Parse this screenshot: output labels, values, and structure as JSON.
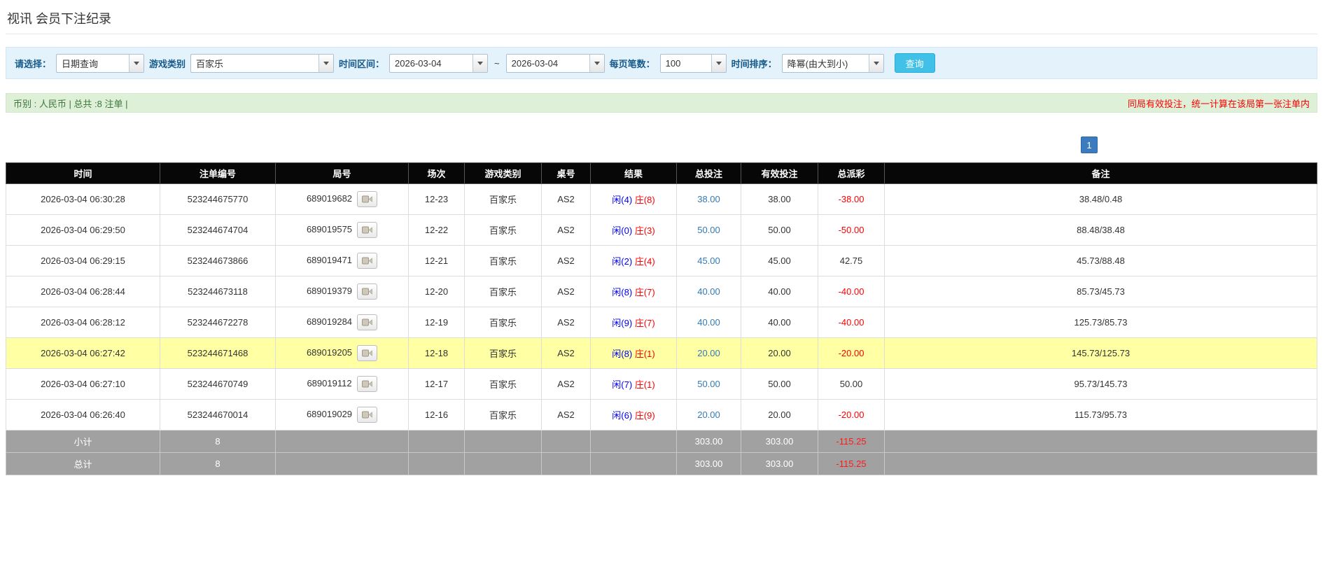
{
  "page": {
    "title": "视讯 会员下注纪录"
  },
  "filters": {
    "select_label": "请选择：",
    "select_value": "日期查询",
    "game_type_label": "游戏类别",
    "game_type_value": "百家乐",
    "time_range_label": "时间区间：",
    "date_from": "2026-03-04",
    "date_separator": "~",
    "date_to": "2026-03-04",
    "page_size_label": "每页笔数：",
    "page_size_value": "100",
    "sort_label": "时间排序：",
    "sort_value": "降幂(由大到小)",
    "search_button": "查询"
  },
  "summary": {
    "left": "币别 : 人民币 | 总共 :8 注单 |",
    "right": "同局有效投注，统一计算在该局第一张注单内"
  },
  "pagination": {
    "current": "1"
  },
  "table": {
    "headers": [
      "时间",
      "注单编号",
      "局号",
      "场次",
      "游戏类别",
      "桌号",
      "结果",
      "总投注",
      "有效投注",
      "总派彩",
      "备注"
    ],
    "rows": [
      {
        "time": "2026-03-04 06:30:28",
        "bet_id": "523244675770",
        "round_id": "689019682",
        "session": "12-23",
        "game": "百家乐",
        "table_no": "AS2",
        "player": "闲(4)",
        "banker": "庄(8)",
        "total_bet": "38.00",
        "valid_bet": "38.00",
        "payout": "-38.00",
        "remark": "38.48/0.48",
        "highlight": false
      },
      {
        "time": "2026-03-04 06:29:50",
        "bet_id": "523244674704",
        "round_id": "689019575",
        "session": "12-22",
        "game": "百家乐",
        "table_no": "AS2",
        "player": "闲(0)",
        "banker": "庄(3)",
        "total_bet": "50.00",
        "valid_bet": "50.00",
        "payout": "-50.00",
        "remark": "88.48/38.48",
        "highlight": false
      },
      {
        "time": "2026-03-04 06:29:15",
        "bet_id": "523244673866",
        "round_id": "689019471",
        "session": "12-21",
        "game": "百家乐",
        "table_no": "AS2",
        "player": "闲(2)",
        "banker": "庄(4)",
        "total_bet": "45.00",
        "valid_bet": "45.00",
        "payout": "42.75",
        "remark": "45.73/88.48",
        "highlight": false
      },
      {
        "time": "2026-03-04 06:28:44",
        "bet_id": "523244673118",
        "round_id": "689019379",
        "session": "12-20",
        "game": "百家乐",
        "table_no": "AS2",
        "player": "闲(8)",
        "banker": "庄(7)",
        "total_bet": "40.00",
        "valid_bet": "40.00",
        "payout": "-40.00",
        "remark": "85.73/45.73",
        "highlight": false
      },
      {
        "time": "2026-03-04 06:28:12",
        "bet_id": "523244672278",
        "round_id": "689019284",
        "session": "12-19",
        "game": "百家乐",
        "table_no": "AS2",
        "player": "闲(9)",
        "banker": "庄(7)",
        "total_bet": "40.00",
        "valid_bet": "40.00",
        "payout": "-40.00",
        "remark": "125.73/85.73",
        "highlight": false
      },
      {
        "time": "2026-03-04 06:27:42",
        "bet_id": "523244671468",
        "round_id": "689019205",
        "session": "12-18",
        "game": "百家乐",
        "table_no": "AS2",
        "player": "闲(8)",
        "banker": "庄(1)",
        "total_bet": "20.00",
        "valid_bet": "20.00",
        "payout": "-20.00",
        "remark": "145.73/125.73",
        "highlight": true
      },
      {
        "time": "2026-03-04 06:27:10",
        "bet_id": "523244670749",
        "round_id": "689019112",
        "session": "12-17",
        "game": "百家乐",
        "table_no": "AS2",
        "player": "闲(7)",
        "banker": "庄(1)",
        "total_bet": "50.00",
        "valid_bet": "50.00",
        "payout": "50.00",
        "remark": "95.73/145.73",
        "highlight": false
      },
      {
        "time": "2026-03-04 06:26:40",
        "bet_id": "523244670014",
        "round_id": "689019029",
        "session": "12-16",
        "game": "百家乐",
        "table_no": "AS2",
        "player": "闲(6)",
        "banker": "庄(9)",
        "total_bet": "20.00",
        "valid_bet": "20.00",
        "payout": "-20.00",
        "remark": "115.73/95.73",
        "highlight": false
      }
    ],
    "subtotal": {
      "label": "小计",
      "count": "8",
      "total_bet": "303.00",
      "valid_bet": "303.00",
      "payout": "-115.25"
    },
    "total": {
      "label": "总计",
      "count": "8",
      "total_bet": "303.00",
      "valid_bet": "303.00",
      "payout": "-115.25"
    }
  },
  "icons": {
    "round_action": "video-icon",
    "combo_arrow": "chevron-down-icon"
  },
  "colors": {
    "accent_button": "#41c0e8",
    "link_blue": "#337ab7",
    "player_blue": "#0000ee",
    "banker_red": "#fe0000",
    "negative_red": "#fe0000",
    "highlight_yellow": "#ffffa3",
    "header_black": "#070707",
    "summary_gray": "#a1a1a1",
    "filter_bg": "#e4f2fb",
    "notice_bg": "#dff0d8",
    "pager_blue": "#3d7bbf"
  }
}
